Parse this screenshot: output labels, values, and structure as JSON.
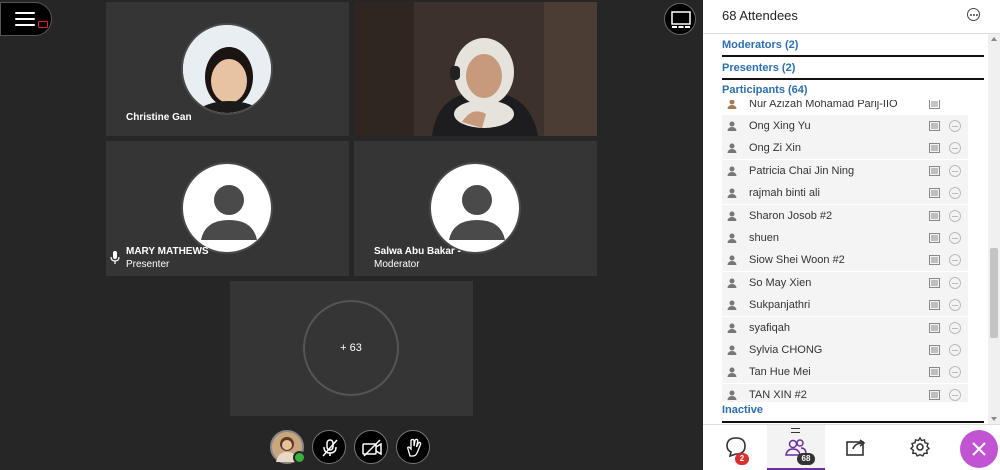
{
  "stage": {
    "tiles": [
      {
        "name": "Christine Gan",
        "role": ""
      },
      {
        "name": "",
        "role": ""
      },
      {
        "name": "MARY MATHEWS",
        "role": "Presenter"
      },
      {
        "name": "Salwa Abu Bakar -",
        "role": "Moderator"
      }
    ],
    "overflow_label": "+ 63"
  },
  "panel": {
    "title": "68 Attendees",
    "sections": {
      "moderators": "Moderators (2)",
      "presenters": "Presenters (2)",
      "participants": "Participants (64)",
      "inactive": "Inactive"
    },
    "partial_row": "Nur Azizah Mohamad Parij-IIO",
    "attendees": [
      "Ong Xing Yu",
      "Ong Zi Xin",
      "Patricia Chai Jin Ning",
      "rajmah binti ali",
      "Sharon Josob #2",
      "shuen",
      "Siow Shei Woon #2",
      "So May Xien",
      "Sukpanjathri",
      "syafiqah",
      "Sylvia CHONG",
      "Tan Hue Mei",
      "TAN XIN #2"
    ],
    "tabs": {
      "chat_badge": "2",
      "attendees_badge": "68"
    }
  },
  "colors": {
    "section_link": "#2a6fb5",
    "active_tab_accent": "#6b2fa0",
    "close_fab": "#c254d4",
    "badge_red": "#d9302b"
  }
}
